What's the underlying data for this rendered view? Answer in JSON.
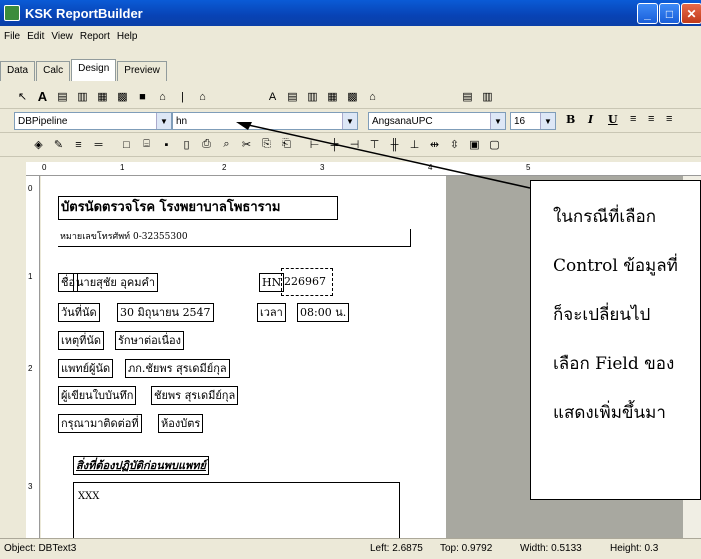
{
  "window": {
    "title": "KSK ReportBuilder"
  },
  "menu": [
    "File",
    "Edit",
    "View",
    "Report",
    "Help"
  ],
  "tabs": [
    "Data",
    "Calc",
    "Design",
    "Preview"
  ],
  "toolbar": {
    "pipeline": "DBPipeline",
    "field": "hn",
    "font": "AngsanaUPC",
    "size": "16",
    "bold": "B",
    "italic": "I",
    "underline": "U"
  },
  "ruler": [
    "0",
    "1",
    "2",
    "3",
    "4",
    "5"
  ],
  "vruler": [
    "0",
    "1",
    "2",
    "3"
  ],
  "report": {
    "title": "บัตรนัดตรวจโรค โรงพยาบาลโพธาราม",
    "phone": "หมายเลขโทรศัพท์ 0-32355300",
    "name_label": "ชื่อ",
    "name_value": "นายสุชัย อุคมคำ",
    "hn_label": "HN",
    "hn_value": "226967",
    "date_label": "วันที่นัด",
    "date_value": "30 มิถุนายน 2547",
    "time_label": "เวลา",
    "time_value": "08:00 น.",
    "reason_label": "เหตุที่นัด",
    "reason_value": "รักษาต่อเนื่อง",
    "doctor_label": "แพทย์ผู้นัด",
    "doctor_value": "ภก.ชัยพร สุรเดมีย์กุล",
    "recorder_label": "ผู้เขียนใบบันทึก",
    "recorder_value": "ชัยพร สุรเดมีย์กุล",
    "contact_label": "กรุณามาติดต่อที่",
    "contact_value": "ห้องบัตร",
    "prep_title": "สิ่งที่ต้องปฏิบัติก่อนพบแพทย์",
    "prep_text": "XXX"
  },
  "callout": [
    "ในกรณีที่เลือก",
    "Control ข้อมูลที่",
    "ก็จะเปลี่ยนไป",
    "เลือก Field ของ",
    "แสดงเพิ่มขึ้นมา"
  ],
  "status": {
    "object": "Object: DBText3",
    "left": "Left: 2.6875",
    "top": "Top: 0.9792",
    "width": "Width: 0.5133",
    "height": "Height: 0.3"
  }
}
